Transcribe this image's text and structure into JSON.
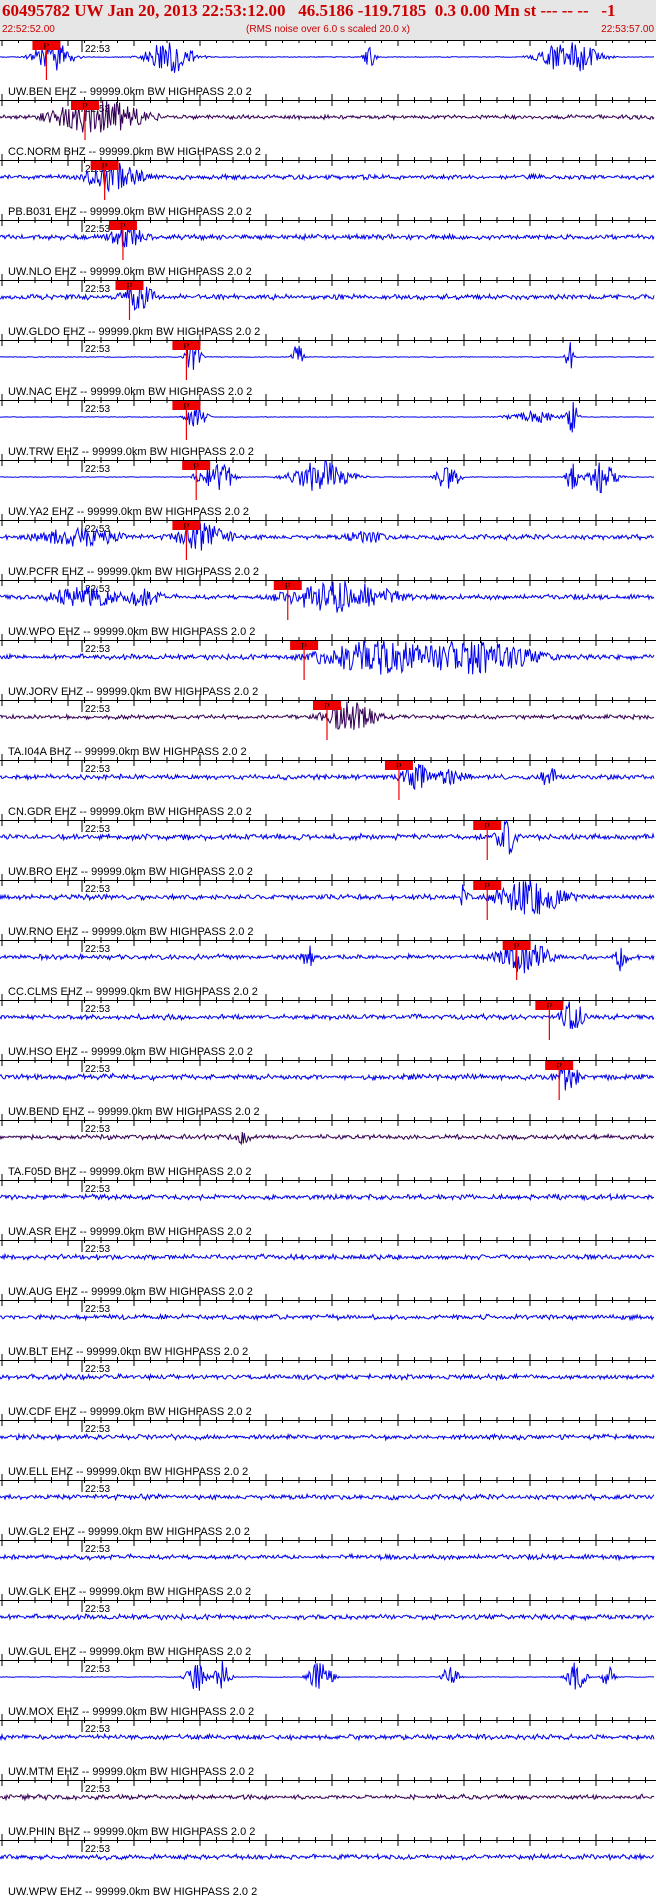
{
  "header": {
    "event_title": "60495782 UW Jan 20, 2013 22:53:12.00   46.5186 -119.7185  0.3 0.00 Mn st --- -- --   -1",
    "start_time": "22:52:52.00",
    "rms_note": "(RMS noise over 6.0 s scaled 20.0 x)",
    "end_time": "22:53:57.00"
  },
  "time_label": "22:53",
  "pick_label": "P",
  "colors": {
    "header_bg": "#e6e6e6",
    "header_text": "#cc0000",
    "trace_blue": "#0000ee",
    "trace_dark": "#330055",
    "pick": "#ee0000",
    "axis": "#000000"
  },
  "traces": [
    {
      "label": "UW.BEN EHZ -- 99999.0km BW  HIGHPASS  2.0  2",
      "color": "trace_blue",
      "style": "spiky",
      "noise": 0.25,
      "pick": 0.071,
      "bursts": [
        {
          "t": 0.08,
          "w": 0.02,
          "a": 1.6
        },
        {
          "t": 0.26,
          "w": 0.025,
          "a": 1.7
        },
        {
          "t": 0.565,
          "w": 0.006,
          "a": 1.2
        },
        {
          "t": 0.87,
          "w": 0.03,
          "a": 1.7
        }
      ]
    },
    {
      "label": "CC.NORM BHZ -- 99999.0km BW  HIGHPASS  2.0  2",
      "color": "trace_dark",
      "style": "wave",
      "noise": 0.25,
      "pick": 0.13,
      "bursts": [
        {
          "t": 0.15,
          "w": 0.05,
          "a": 1.8
        }
      ]
    },
    {
      "label": "PB.B031 EHZ -- 99999.0km BW  HIGHPASS  2.0  2",
      "color": "trace_blue",
      "style": "wave",
      "noise": 0.28,
      "pick": 0.16,
      "bursts": [
        {
          "t": 0.175,
          "w": 0.03,
          "a": 1.6
        }
      ]
    },
    {
      "label": "UW.NLO EHZ -- 99999.0km BW  HIGHPASS  2.0  2",
      "color": "trace_blue",
      "style": "wave",
      "noise": 0.3,
      "pick": 0.188,
      "bursts": [
        {
          "t": 0.195,
          "w": 0.02,
          "a": 1.3
        }
      ]
    },
    {
      "label": "UW.GLDO EHZ -- 99999.0km BW  HIGHPASS  2.0  2",
      "color": "trace_blue",
      "style": "wave",
      "noise": 0.3,
      "pick": 0.198,
      "bursts": [
        {
          "t": 0.21,
          "w": 0.02,
          "a": 1.4
        }
      ]
    },
    {
      "label": "UW.NAC EHZ -- 99999.0km BW  HIGHPASS  2.0  2",
      "color": "trace_blue",
      "style": "spiky",
      "noise": 0.22,
      "pick": 0.285,
      "bursts": [
        {
          "t": 0.295,
          "w": 0.008,
          "a": 1.7
        },
        {
          "t": 0.455,
          "w": 0.006,
          "a": 1.4
        },
        {
          "t": 0.87,
          "w": 0.004,
          "a": 1.7
        }
      ]
    },
    {
      "label": "UW.TRW EHZ -- 99999.0km BW  HIGHPASS  2.0  2",
      "color": "trace_blue",
      "style": "spiky",
      "noise": 0.18,
      "pick": 0.285,
      "bursts": [
        {
          "t": 0.3,
          "w": 0.01,
          "a": 1.5
        },
        {
          "t": 0.82,
          "w": 0.03,
          "a": 0.6
        },
        {
          "t": 0.875,
          "w": 0.006,
          "a": 1.6
        }
      ]
    },
    {
      "label": "UW.YA2 EHZ -- 99999.0km BW  HIGHPASS  2.0  2",
      "color": "trace_blue",
      "style": "spiky",
      "noise": 0.2,
      "pick": 0.3,
      "bursts": [
        {
          "t": 0.31,
          "w": 0.008,
          "a": 1.6
        },
        {
          "t": 0.34,
          "w": 0.012,
          "a": 1.6
        },
        {
          "t": 0.49,
          "w": 0.03,
          "a": 1.7
        },
        {
          "t": 0.685,
          "w": 0.012,
          "a": 1.5
        },
        {
          "t": 0.875,
          "w": 0.006,
          "a": 1.6
        },
        {
          "t": 0.92,
          "w": 0.015,
          "a": 1.6
        }
      ]
    },
    {
      "label": "UW.PCFR EHZ -- 99999.0km BW  HIGHPASS  2.0  2",
      "color": "trace_blue",
      "style": "wave",
      "noise": 0.3,
      "pick": 0.285,
      "bursts": [
        {
          "t": 0.12,
          "w": 0.05,
          "a": 1.0
        },
        {
          "t": 0.31,
          "w": 0.03,
          "a": 1.4
        },
        {
          "t": 0.56,
          "w": 0.025,
          "a": 0.7
        }
      ]
    },
    {
      "label": "UW.WPO EHZ -- 99999.0km BW  HIGHPASS  2.0  2",
      "color": "trace_blue",
      "style": "wave",
      "noise": 0.3,
      "pick": 0.44,
      "bursts": [
        {
          "t": 0.13,
          "w": 0.04,
          "a": 1.2
        },
        {
          "t": 0.22,
          "w": 0.02,
          "a": 1.1
        },
        {
          "t": 0.52,
          "w": 0.06,
          "a": 1.7
        }
      ]
    },
    {
      "label": "UW.JORV EHZ -- 99999.0km BW  HIGHPASS  2.0  2",
      "color": "trace_blue",
      "style": "wave",
      "noise": 0.3,
      "pick": 0.465,
      "bursts": [
        {
          "t": 0.58,
          "w": 0.07,
          "a": 1.8
        },
        {
          "t": 0.72,
          "w": 0.07,
          "a": 1.8
        }
      ]
    },
    {
      "label": "TA.I04A BHZ -- 99999.0km BW  HIGHPASS  2.0  2",
      "color": "trace_dark",
      "style": "wave",
      "noise": 0.25,
      "pick": 0.5,
      "bursts": [
        {
          "t": 0.535,
          "w": 0.03,
          "a": 1.6
        }
      ]
    },
    {
      "label": "CN.GDR EHZ -- 99999.0km BW  HIGHPASS  2.0  2",
      "color": "trace_blue",
      "style": "wave",
      "noise": 0.3,
      "pick": 0.61,
      "bursts": [
        {
          "t": 0.64,
          "w": 0.02,
          "a": 1.3
        },
        {
          "t": 0.69,
          "w": 0.02,
          "a": 0.9
        },
        {
          "t": 0.84,
          "w": 0.012,
          "a": 1.0
        }
      ]
    },
    {
      "label": "UW.BRO EHZ -- 99999.0km BW  HIGHPASS  2.0  2",
      "color": "trace_blue",
      "style": "wave",
      "noise": 0.35,
      "pick": 0.745,
      "bursts": [
        {
          "t": 0.775,
          "w": 0.012,
          "a": 1.9
        }
      ]
    },
    {
      "label": "UW.RNO EHZ -- 99999.0km BW  HIGHPASS  2.0  2",
      "color": "trace_blue",
      "style": "wave",
      "noise": 0.3,
      "pick": 0.745,
      "bursts": [
        {
          "t": 0.71,
          "w": 0.004,
          "a": 1.6
        },
        {
          "t": 0.815,
          "w": 0.04,
          "a": 1.9
        }
      ]
    },
    {
      "label": "CC.CLMS EHZ -- 99999.0km BW  HIGHPASS  2.0  2",
      "color": "trace_blue",
      "style": "wave",
      "noise": 0.3,
      "pick": 0.79,
      "bursts": [
        {
          "t": 0.47,
          "w": 0.006,
          "a": 1.6
        },
        {
          "t": 0.8,
          "w": 0.03,
          "a": 1.7
        },
        {
          "t": 0.95,
          "w": 0.006,
          "a": 1.5
        }
      ]
    },
    {
      "label": "UW.HSO EHZ -- 99999.0km BW  HIGHPASS  2.0  2",
      "color": "trace_blue",
      "style": "wave",
      "noise": 0.3,
      "pick": 0.84,
      "bursts": [
        {
          "t": 0.875,
          "w": 0.012,
          "a": 1.9
        }
      ]
    },
    {
      "label": "UW.BEND EHZ -- 99999.0km BW  HIGHPASS  2.0  2",
      "color": "trace_blue",
      "style": "wave",
      "noise": 0.35,
      "pick": 0.855,
      "bursts": [
        {
          "t": 0.87,
          "w": 0.01,
          "a": 1.6
        }
      ]
    },
    {
      "label": "TA.F05D BHZ -- 99999.0km BW  HIGHPASS  2.0  2",
      "color": "trace_dark",
      "style": "wave",
      "noise": 0.28,
      "pick": null,
      "bursts": [
        {
          "t": 0.37,
          "w": 0.01,
          "a": 0.8
        }
      ]
    },
    {
      "label": "UW.ASR EHZ -- 99999.0km BW  HIGHPASS  2.0  2",
      "color": "trace_blue",
      "style": "wave",
      "noise": 0.3,
      "pick": null,
      "bursts": []
    },
    {
      "label": "UW.AUG EHZ -- 99999.0km BW  HIGHPASS  2.0  2",
      "color": "trace_blue",
      "style": "wave",
      "noise": 0.3,
      "pick": null,
      "bursts": []
    },
    {
      "label": "UW.BLT EHZ -- 99999.0km BW  HIGHPASS  2.0  2",
      "color": "trace_blue",
      "style": "wave",
      "noise": 0.3,
      "pick": null,
      "bursts": []
    },
    {
      "label": "UW.CDF EHZ -- 99999.0km BW  HIGHPASS  2.0  2",
      "color": "trace_blue",
      "style": "wave",
      "noise": 0.3,
      "pick": null,
      "bursts": []
    },
    {
      "label": "UW.ELL EHZ -- 99999.0km BW  HIGHPASS  2.0  2",
      "color": "trace_blue",
      "style": "wave",
      "noise": 0.3,
      "pick": null,
      "bursts": []
    },
    {
      "label": "UW.GL2 EHZ -- 99999.0km BW  HIGHPASS  2.0  2",
      "color": "trace_blue",
      "style": "wave",
      "noise": 0.3,
      "pick": null,
      "bursts": []
    },
    {
      "label": "UW.GLK EHZ -- 99999.0km BW  HIGHPASS  2.0  2",
      "color": "trace_blue",
      "style": "wave",
      "noise": 0.3,
      "pick": null,
      "bursts": []
    },
    {
      "label": "UW.GUL EHZ -- 99999.0km BW  HIGHPASS  2.0  2",
      "color": "trace_blue",
      "style": "wave",
      "noise": 0.3,
      "pick": null,
      "bursts": []
    },
    {
      "label": "UW.MOX EHZ -- 99999.0km BW  HIGHPASS  2.0  2",
      "color": "trace_blue",
      "style": "spiky",
      "noise": 0.2,
      "pick": null,
      "bursts": [
        {
          "t": 0.3,
          "w": 0.01,
          "a": 1.6
        },
        {
          "t": 0.34,
          "w": 0.008,
          "a": 1.6
        },
        {
          "t": 0.49,
          "w": 0.012,
          "a": 1.6
        },
        {
          "t": 0.69,
          "w": 0.008,
          "a": 1.6
        },
        {
          "t": 0.88,
          "w": 0.01,
          "a": 1.5
        },
        {
          "t": 0.93,
          "w": 0.006,
          "a": 1.4
        }
      ]
    },
    {
      "label": "UW.MTM EHZ -- 99999.0km BW  HIGHPASS  2.0  2",
      "color": "trace_blue",
      "style": "wave",
      "noise": 0.3,
      "pick": null,
      "bursts": []
    },
    {
      "label": "UW.PHIN BHZ -- 99999.0km BW  HIGHPASS  2.0  2",
      "color": "trace_dark",
      "style": "wave",
      "noise": 0.28,
      "pick": null,
      "bursts": []
    },
    {
      "label": "UW.WPW EHZ -- 99999.0km BW  HIGHPASS  2.0  2",
      "color": "trace_blue",
      "style": "wave",
      "noise": 0.3,
      "pick": null,
      "bursts": []
    }
  ]
}
